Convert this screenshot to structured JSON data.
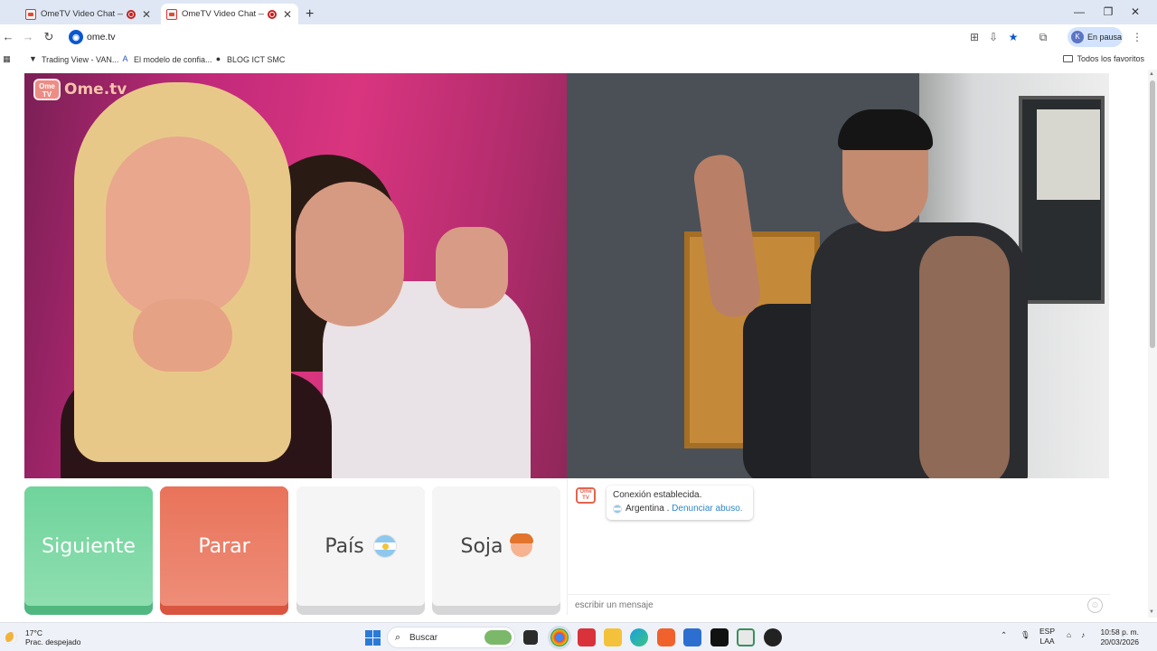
{
  "browser": {
    "tabs": [
      {
        "title": "OmeTV Video Chat — Alter",
        "active": false
      },
      {
        "title": "OmeTV Video Chat — Alter",
        "active": true
      }
    ],
    "new_tab_icon": "plus-icon",
    "url": "ome.tv",
    "profile_initial": "K",
    "profile_label": "En pausa",
    "bookmarks": [
      {
        "label": "Trading View - VAN...",
        "icon": "tradingview-icon"
      },
      {
        "label": "El modelo de confia...",
        "icon": "a-logo-icon"
      },
      {
        "label": "BLOG ICT SMC",
        "icon": "blog-icon"
      }
    ],
    "bookmarks_folder": "Todos los favoritos"
  },
  "page": {
    "watermark": {
      "badge": "Ome TV",
      "brand": "Ome.tv"
    },
    "buttons": {
      "next": "Siguiente",
      "stop": "Parar",
      "country": "País",
      "gender": "Soja"
    },
    "chat": {
      "logo": "Ome TV",
      "status": "Conexión establecida.",
      "country": "Argentina",
      "separator": " . ",
      "report_link": "Denunciar abuso.",
      "input_placeholder": "escribir un mensaje"
    },
    "colors": {
      "next": "#6fd49b",
      "stop": "#e9735a",
      "link": "#2b87c6"
    }
  },
  "taskbar": {
    "weather_temp": "17°C",
    "weather_desc": "Prac. despejado",
    "search_label": "Buscar",
    "lang_line1": "ESP",
    "lang_line2": "LAA",
    "time": "10:58 p. m.",
    "date": "20/03/2026"
  }
}
